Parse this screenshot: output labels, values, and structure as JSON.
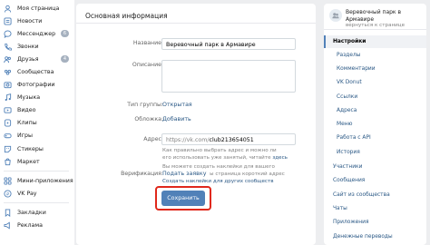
{
  "left_nav": {
    "items": [
      {
        "label": "Моя страница",
        "icon": "user-icon",
        "badge": ""
      },
      {
        "label": "Новости",
        "icon": "news-icon",
        "badge": ""
      },
      {
        "label": "Мессенджер",
        "icon": "messenger-icon",
        "badge": "6"
      },
      {
        "label": "Звонки",
        "icon": "phone-icon",
        "badge": ""
      },
      {
        "label": "Друзья",
        "icon": "friends-icon",
        "badge": "4"
      },
      {
        "label": "Сообщества",
        "icon": "communities-icon",
        "badge": ""
      },
      {
        "label": "Фотографии",
        "icon": "photo-icon",
        "badge": ""
      },
      {
        "label": "Музыка",
        "icon": "music-icon",
        "badge": ""
      },
      {
        "label": "Видео",
        "icon": "video-icon",
        "badge": ""
      },
      {
        "label": "Клипы",
        "icon": "clips-icon",
        "badge": ""
      },
      {
        "label": "Игры",
        "icon": "games-icon",
        "badge": ""
      },
      {
        "label": "Стикеры",
        "icon": "stickers-icon",
        "badge": ""
      },
      {
        "label": "Маркет",
        "icon": "market-icon",
        "badge": ""
      }
    ],
    "items_secondary": [
      {
        "label": "Мини-приложения",
        "icon": "apps-icon"
      },
      {
        "label": "VK Pay",
        "icon": "vkpay-icon"
      }
    ],
    "items_tertiary": [
      {
        "label": "Закладки",
        "icon": "bookmark-icon"
      },
      {
        "label": "Реклама",
        "icon": "ads-icon"
      }
    ]
  },
  "main": {
    "header": "Основная информация",
    "name_label": "Название:",
    "name_value": "Веревочный парк в Армавире",
    "description_label": "Описание:",
    "description_value": "",
    "group_type_label": "Тип группы:",
    "group_type_value": "Открытая",
    "cover_label": "Обложка:",
    "cover_value": "Добавить",
    "address_label": "Адрес:",
    "address_prefix": "https://vk.com/",
    "address_value": "club213654051",
    "hint1_line1": "Как правильно выбрать адрес и можно ли",
    "hint1_line2": "его использовать уже занятый, читайте",
    "hint1_link": "здесь",
    "hint2_line1": "Вы можете создать наклейки для вашего",
    "hint2_line2": "сообщества, чтобы страница короткий адрес",
    "hint2_link": "Создать наклейки для других сообществ",
    "verification_label": "Верификация:",
    "verification_value": "Подать заявку",
    "save_label": "Сохранить"
  },
  "right": {
    "group_name": "Веревочный парк в Армавире",
    "group_back": "вернуться к странице",
    "settings_label": "Настройки",
    "sub_items": [
      "Разделы",
      "Комментарии",
      "VK Donut",
      "Ссылки",
      "Адреса",
      "Меню",
      "Работа с API",
      "История"
    ],
    "main_items": [
      "Участники",
      "Сообщения",
      "Сайт из сообщества",
      "Чаты",
      "Приложения",
      "Денежные переводы"
    ]
  },
  "colors": {
    "accent": "#5181b8",
    "link": "#2a5885",
    "highlight": "#e0281b",
    "background": "#edeef0"
  }
}
